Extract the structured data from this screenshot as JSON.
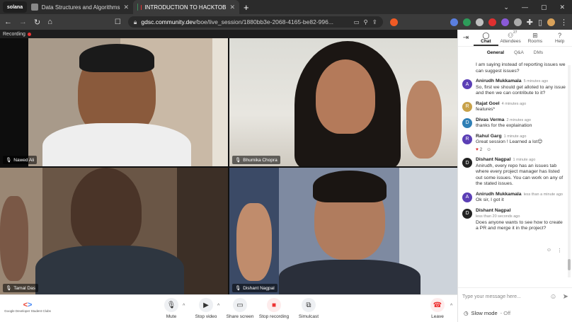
{
  "browser": {
    "pinned_tab": "solana",
    "tabs": [
      {
        "title": "Data Structures and Algorithms"
      },
      {
        "title": "INTRODUCTION TO HACKTOB"
      }
    ],
    "url_host": "gdsc.community.dev",
    "url_path": "/boe/live_session/1880bb3e-2068-4165-be82-996..."
  },
  "recording": {
    "label": "Recording"
  },
  "participants": [
    {
      "name": "Nawed Ali"
    },
    {
      "name": "Bhumika Chopra"
    },
    {
      "name": "Tamal Das"
    },
    {
      "name": "Dishant Nagpal"
    }
  ],
  "toolbar": {
    "brand": "Google Developer Student Clubs",
    "mute": "Mute",
    "stop_video": "Stop video",
    "share_screen": "Share screen",
    "stop_recording": "Stop recording",
    "simulcast": "Simulcast",
    "leave": "Leave"
  },
  "sidebar": {
    "nav": [
      {
        "label": "Chat",
        "icon": "chat-icon"
      },
      {
        "label": "Attendees",
        "icon": "people-icon",
        "badge": "27"
      },
      {
        "label": "Rooms",
        "icon": "grid-icon"
      },
      {
        "label": "Help",
        "icon": "help-icon"
      }
    ],
    "subtabs": [
      "General",
      "Q&A",
      "DMs"
    ],
    "messages": [
      {
        "name": "",
        "time": "",
        "text": "I am saying instead of reporting issues we can suggest issues?",
        "avatar": "",
        "avatar_color": ""
      },
      {
        "name": "Anirudh Mukkamala",
        "time": "5 minutes ago",
        "text": "So, first we should get alloted to any issue and then we can contribute to it?",
        "avatar": "A",
        "avatar_color": "#5b3fb5"
      },
      {
        "name": "Rajat Goel",
        "time": "4 minutes ago",
        "text": "features*",
        "avatar": "R",
        "avatar_color": "#c8a24a"
      },
      {
        "name": "Divas Verma",
        "time": "2 minutes ago",
        "text": "thanks for the explaination",
        "avatar": "D",
        "avatar_color": "#2f7fb5"
      },
      {
        "name": "Rahul Garg",
        "time": "1 minute ago",
        "text": "Great session ! Learned a lot😊",
        "avatar": "R",
        "avatar_color": "#5b3fb5",
        "reaction_count": "2"
      },
      {
        "name": "Dishant Nagpal",
        "time": "1 minute ago",
        "text": "Anirudh, every repo has an issues tab where every project manager has listed out some issues. You can work on any of the stated issues.",
        "avatar": "D",
        "avatar_color": "#222"
      },
      {
        "name": "Anirudh Mukkamala",
        "time": "less than a minute ago",
        "text": "Ok sir, I got it",
        "avatar": "A",
        "avatar_color": "#5b3fb5"
      },
      {
        "name": "Dishant Nagpal",
        "time": "less than 20 seconds ago",
        "text": "Does anyone wants to see how to create a PR and merge it in the project?",
        "avatar": "D",
        "avatar_color": "#222"
      }
    ],
    "input_placeholder": "Type your message here...",
    "slow_mode": "Slow mode",
    "slow_mode_state": "- Off"
  }
}
